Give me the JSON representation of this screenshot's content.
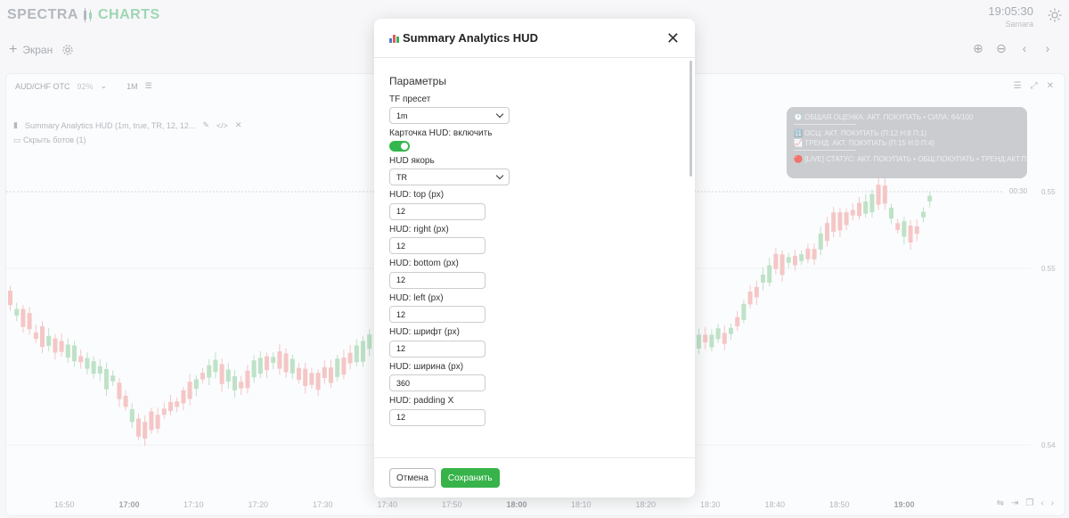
{
  "app": {
    "logo_part1": "SPECTRA",
    "logo_part2": "CHARTS",
    "time": "19:05:30",
    "timezone": "Samara"
  },
  "toolbar": {
    "screen_label": "Экран"
  },
  "chart_panel": {
    "symbol": "AUD/CHF OTC",
    "payout": "92%",
    "timeframe": "1M",
    "indicator_title": "Summary Analytics HUD (1m, true, TR, 12, 12...",
    "hide_bots": "Скрыть ботов (1)",
    "price_tag_time": "00:30",
    "price_labels": [
      "0.55",
      "0.55",
      "0.54"
    ],
    "time_labels": [
      "16:50",
      "17:00",
      "17:10",
      "17:20",
      "17:30",
      "17:40",
      "17:50",
      "18:00",
      "18:10",
      "18:20",
      "18:30",
      "18:40",
      "18:50",
      "19:00"
    ],
    "bold_time_labels": [
      "17:00",
      "18:00",
      "19:00"
    ]
  },
  "hud_card": {
    "line1": "🕐 ОБЩАЯ ОЦЕНКА: АКТ. ПОКУПАТЬ • СИЛА: 64/100",
    "line2": "🔢 ОСЦ: АКТ. ПОКУПАТЬ (П:12 Н:8 П:1)",
    "line3": "📈 ТРЕНД: АКТ. ПОКУПАТЬ (П:15 Н:0 П:4)",
    "line4": "🔴 [LIVE] СТАТУС: АКТ. ПОКУПАТЬ • ОБЩ:ПОКУПАТЬ • ТРЕНД:АКТ.П"
  },
  "modal": {
    "title": "Summary Analytics HUD",
    "section_title": "Параметры",
    "fields": {
      "tf_preset": {
        "label": "TF пресет",
        "value": "1m"
      },
      "hud_enable": {
        "label": "Карточка HUD: включить",
        "value": true
      },
      "hud_anchor": {
        "label": "HUD якорь",
        "value": "TR"
      },
      "hud_top": {
        "label": "HUD: top (px)",
        "value": "12"
      },
      "hud_right": {
        "label": "HUD: right (px)",
        "value": "12"
      },
      "hud_bottom": {
        "label": "HUD: bottom (px)",
        "value": "12"
      },
      "hud_left": {
        "label": "HUD: left (px)",
        "value": "12"
      },
      "hud_font": {
        "label": "HUD: шрифт (px)",
        "value": "12"
      },
      "hud_width": {
        "label": "HUD: ширина (px)",
        "value": "360"
      },
      "hud_padding_x": {
        "label": "HUD: padding X",
        "value": "12"
      }
    },
    "cancel_label": "Отмена",
    "save_label": "Сохранить"
  },
  "colors": {
    "accent_green": "#37b34a",
    "candle_up": "#a8d8b4",
    "candle_down": "#f2b3b3"
  },
  "icons": [
    "settings-gear-icon",
    "plus-icon",
    "sun-icon",
    "zoom-in-icon",
    "zoom-out-icon",
    "chevron-left-icon",
    "chevron-right-icon",
    "close-icon",
    "bar-chart-icon",
    "chevron-down-icon",
    "menu-icon",
    "pencil-icon",
    "code-icon",
    "expand-icon"
  ]
}
